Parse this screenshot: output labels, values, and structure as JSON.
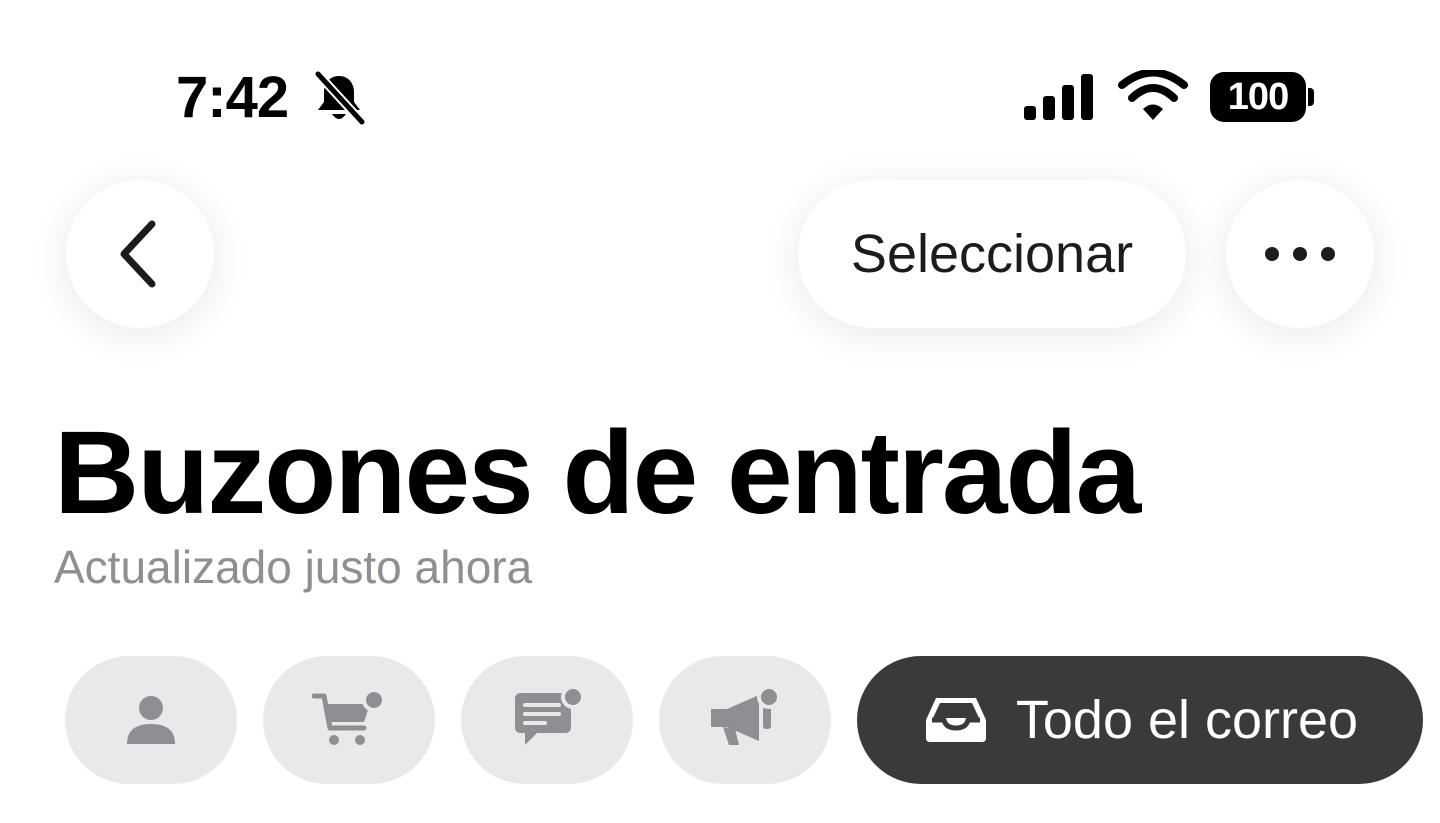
{
  "status_bar": {
    "time": "7:42",
    "battery_level": "100",
    "icons": [
      "bell-slash-icon",
      "cellular-signal-icon",
      "wifi-icon",
      "battery-icon"
    ]
  },
  "nav": {
    "back_icon": "chevron-left-icon",
    "select_label": "Seleccionar",
    "more_icon": "ellipsis-icon"
  },
  "header": {
    "title": "Buzones de entrada",
    "subtitle": "Actualizado justo ahora"
  },
  "categories": [
    {
      "icon": "person-icon",
      "selected": false
    },
    {
      "icon": "shopping-cart-icon",
      "selected": false,
      "badge": true
    },
    {
      "icon": "chat-bubble-icon",
      "selected": false,
      "badge": true
    },
    {
      "icon": "megaphone-icon",
      "selected": false,
      "badge": true
    },
    {
      "icon": "tray-icon",
      "label": "Todo el correo",
      "selected": true
    }
  ],
  "colors": {
    "chip_bg": "#e9e9eb",
    "chip_icon": "#8e8e93",
    "selected_chip_bg": "#3a3a3c",
    "subtitle": "#8e8e93"
  }
}
